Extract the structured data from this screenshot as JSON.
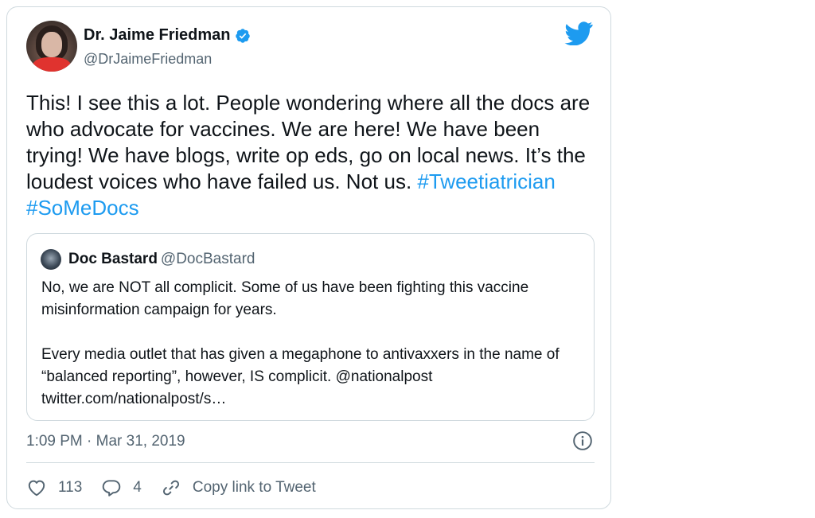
{
  "author": {
    "name": "Dr. Jaime Friedman",
    "handle": "@DrJaimeFriedman"
  },
  "tweet": {
    "text_before": "This! I see this a lot. People wondering where all the docs are who advocate for vaccines. We are here! We have been trying! We have blogs, write op eds, go on local news. It’s the loudest voices who have failed us. Not us. ",
    "hashtags": [
      "#Tweetiatrician",
      "#SoMeDocs"
    ]
  },
  "quoted": {
    "name": "Doc Bastard",
    "handle": "@DocBastard",
    "paragraph1": "No, we are NOT all complicit. Some of us have been fighting this vaccine misinformation campaign for years.",
    "paragraph2_line1": "Every media outlet that has given a megaphone to antivaxxers in the name of “balanced reporting”, however, IS complicit. @nationalpost",
    "paragraph2_line2": "twitter.com/nationalpost/s…"
  },
  "meta": {
    "timestamp": "1:09 PM · Mar 31, 2019"
  },
  "actions": {
    "likes": "113",
    "replies": "4",
    "copy_link": "Copy link to Tweet"
  },
  "colors": {
    "accent": "#1d9bf0",
    "secondary_text": "#536471",
    "border": "#cfd9de"
  },
  "icons": [
    "verified-badge-icon",
    "twitter-bird-icon",
    "info-icon",
    "heart-icon",
    "reply-icon",
    "link-icon"
  ]
}
